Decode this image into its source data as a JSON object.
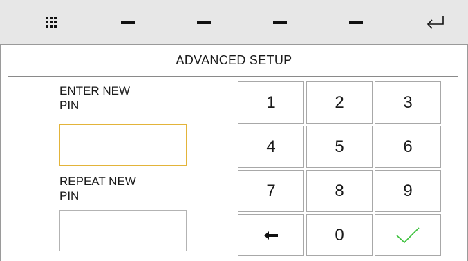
{
  "toolbar": {
    "menu_icon": "grid-icon",
    "slot_icons": [
      "dash-icon",
      "dash-icon",
      "dash-icon",
      "dash-icon"
    ],
    "back_icon": "return-arrow-icon"
  },
  "screen": {
    "title": "ADVANCED SETUP"
  },
  "form": {
    "new_pin_label": "ENTER NEW\nPIN",
    "new_pin_value": "",
    "repeat_pin_label": "REPEAT NEW\nPIN",
    "repeat_pin_value": ""
  },
  "keypad": {
    "keys": [
      "1",
      "2",
      "3",
      "4",
      "5",
      "6",
      "7",
      "8",
      "9"
    ],
    "zero": "0",
    "backspace_icon": "left-arrow-icon",
    "confirm_icon": "checkmark-icon"
  },
  "colors": {
    "active_field_border": "#e3b43a",
    "confirm_green": "#3cc13c",
    "toolbar_bg": "#e7e7e7"
  }
}
